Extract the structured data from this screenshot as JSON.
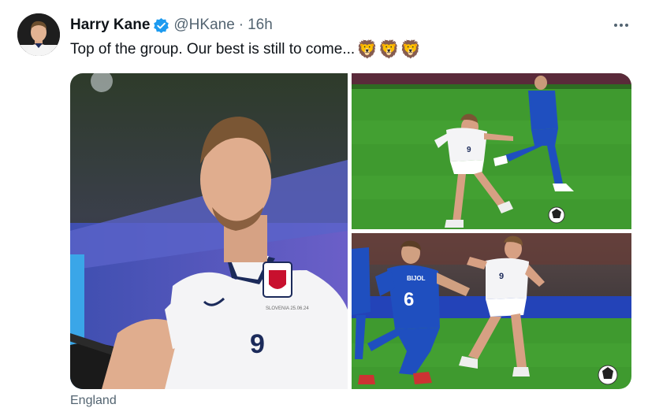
{
  "tweet": {
    "author_name": "Harry Kane",
    "handle": "@HKane",
    "separator": "·",
    "time": "16h",
    "text": "Top of the group. Our best is still to come...",
    "emoji": "🦁🦁🦁",
    "more_icon": "ellipsis-icon",
    "verified_icon": "verified-badge-icon",
    "verified_color": "#1d9bf0"
  },
  "media": {
    "photos": [
      {
        "kit_number": "9",
        "crest_text": "SLOVENIA 25.06.24"
      },
      {
        "kit_number": "9"
      },
      {
        "kit_number": "6",
        "shirt_name": "BIJOL",
        "kit_number_white": "9"
      }
    ]
  },
  "footer": {
    "label": "England"
  },
  "colors": {
    "text_primary": "#0f1419",
    "text_secondary": "#536471",
    "pitch_green": "#3f9a2f",
    "slovenia_blue": "#1f4fbf"
  }
}
